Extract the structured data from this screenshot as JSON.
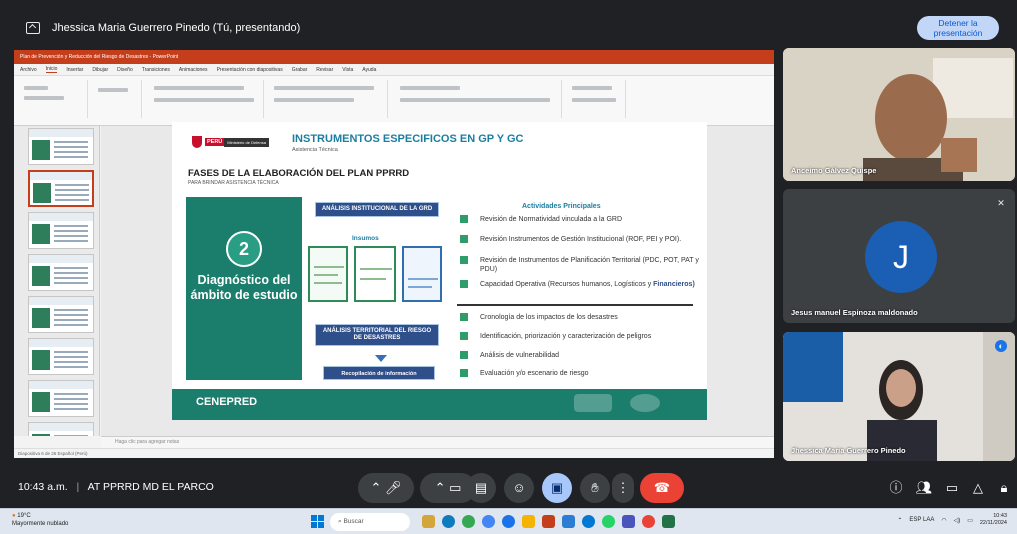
{
  "presenter_bar": {
    "title": "Jhessica Maria Guerrero Pinedo (Tú, presentando)",
    "stop_button": "Detener la presentación"
  },
  "ppt": {
    "window_title": "Plan de Prevención y Reducción del Riesgo de Desastres - PowerPoint",
    "tabs": [
      "Archivo",
      "Inicio",
      "Insertar",
      "Dibujar",
      "Diseño",
      "Transiciones",
      "Animaciones",
      "Presentación con diapositivas",
      "Grabar",
      "Revisar",
      "Vista",
      "Ayuda"
    ],
    "notes_placeholder": "Haga clic para agregar notas",
    "status": "Diapositiva 6 de 26    Español (Perú)"
  },
  "slide": {
    "peru_label": "PERÚ",
    "ministry_label": "Ministerio de Defensa",
    "title": "INSTRUMENTOS ESPECIFICOS EN GP Y GC",
    "subtitle": "Asistencia Técnica",
    "phase_title": "FASES DE LA ELABORACIÓN DEL PLAN PPRRD",
    "phase_subtitle": "PARA BRINDAR ASISTENCIA TÉCNICA",
    "step_number": "2",
    "step_label": "Diagnóstico del ámbito de estudio",
    "label_grd": "ANÁLISIS INSTITUCIONAL DE LA GRD",
    "insumos": "Insumos",
    "label_territorial": "ANÁLISIS TERRITORIAL DEL RIESGO DE DESASTRES",
    "recopilacion": "Recopilación de información",
    "activities_title": "Actividades Principales",
    "activities_top": [
      "Revisión de Normatividad vinculada a la GRD",
      "Revisión Instrumentos de Gestión Institucional (ROF, PEI y POI).",
      "Revisión de Instrumentos de Planificación Territorial (PDC, POT, PAT y PDU)",
      "Capacidad Operativa (Recursos humanos, Logísticos y"
    ],
    "activities_top_suffix": "Financieros)",
    "activities_bottom": [
      "Cronología de los impactos de los desastres",
      "Identificación, priorización y caracterización de peligros",
      "Análisis de vulnerabilidad",
      "Evaluación y/o escenario de riesgo"
    ],
    "footer_logo": "CENEPRED"
  },
  "participants": {
    "p1": "Anceimo Gálvez Quispe",
    "p2": "Jesus manuel Espinoza maldonado",
    "p2_initial": "J",
    "p3": "Jhessica Maria Guerrero Pinedo"
  },
  "controls": {
    "time": "10:43 a.m.",
    "separator": "|",
    "meeting": "AT PPRRD MD EL PARCO"
  },
  "taskbar": {
    "weather_temp": "19°C",
    "weather_desc": "Mayormente nublado",
    "search_placeholder": "Buscar",
    "lang": "ESP LAA",
    "time": "10:43",
    "date": "22/11/2024"
  }
}
